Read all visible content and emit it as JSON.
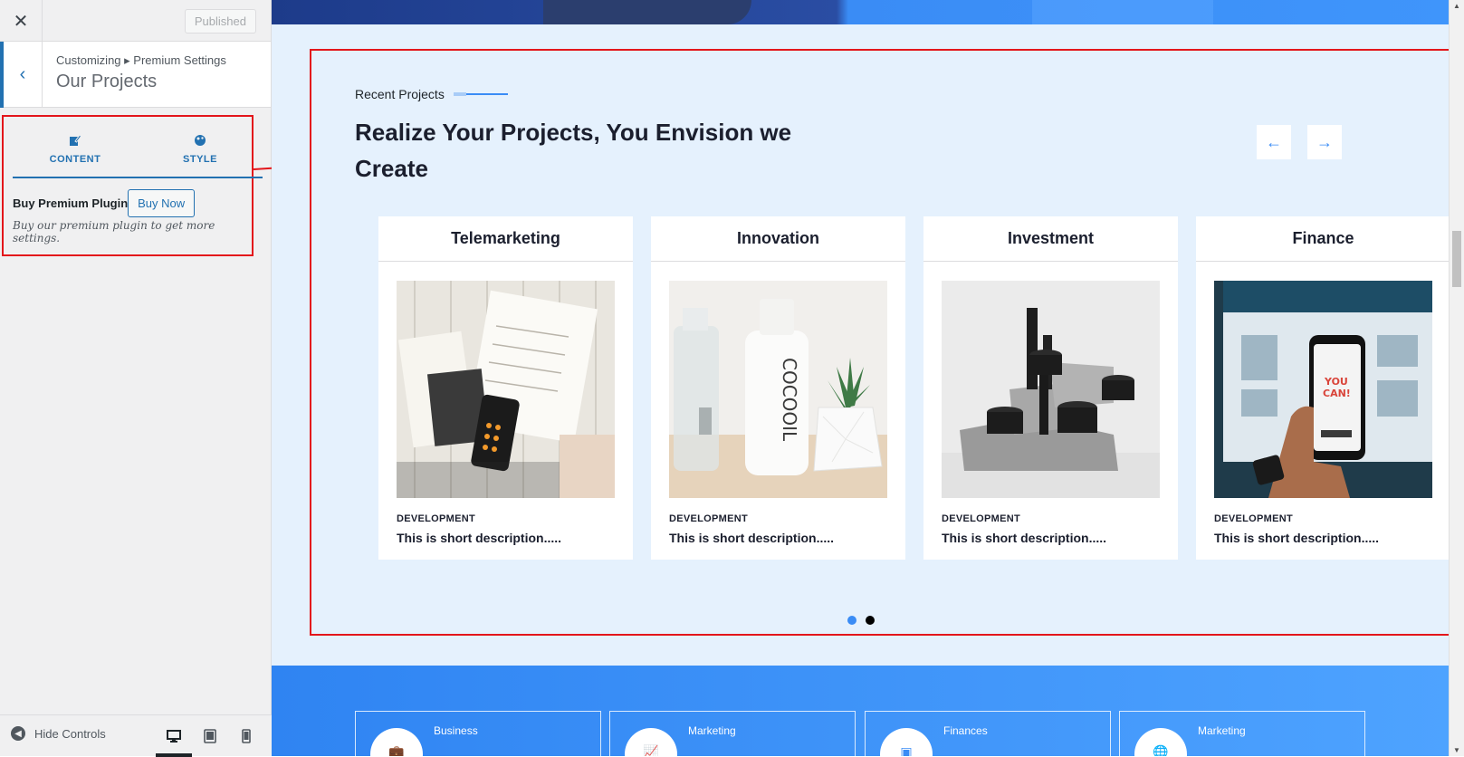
{
  "customizer": {
    "close_icon": "close-icon",
    "publish_label": "Published",
    "breadcrumb": "Customizing ▸ Premium Settings",
    "section_title": "Our Projects",
    "tabs": [
      {
        "label": "CONTENT",
        "icon": "edit-icon"
      },
      {
        "label": "STYLE",
        "icon": "palette-icon"
      }
    ],
    "buy_label": "Buy Premium Plugin",
    "buy_button": "Buy Now",
    "buy_description": "Buy our premium plugin to get more settings.",
    "hide_controls": "Hide Controls",
    "devices": [
      "desktop",
      "tablet",
      "mobile"
    ],
    "accent_color": "#2271b1",
    "highlight_color": "#e3161b"
  },
  "preview": {
    "eyebrow": "Recent Projects",
    "heading": "Realize Your Projects, You Envision we Create",
    "cards": [
      {
        "title": "Telemarketing",
        "category": "DEVELOPMENT",
        "description": "This is short description....."
      },
      {
        "title": "Innovation",
        "category": "DEVELOPMENT",
        "description": "This is short description....."
      },
      {
        "title": "Investment",
        "category": "DEVELOPMENT",
        "description": "This is short description....."
      },
      {
        "title": "Finance",
        "category": "DEVELOPMENT",
        "description": "This is short description....."
      }
    ],
    "pagination": {
      "pages": 2,
      "active": 1
    },
    "features": [
      {
        "label": "Business",
        "icon": "briefcase-icon"
      },
      {
        "label": "Marketing",
        "icon": "chart-icon"
      },
      {
        "label": "Finances",
        "icon": "finance-icon"
      },
      {
        "label": "Marketing",
        "icon": "globe-icon"
      }
    ],
    "accent_color": "#3a8cf5"
  }
}
